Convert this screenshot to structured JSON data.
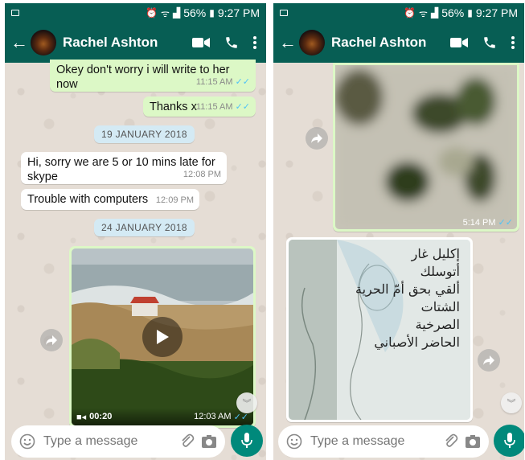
{
  "status_bar": {
    "battery": "56%",
    "time": "9:27 PM"
  },
  "contact": {
    "name": "Rachel Ashton"
  },
  "left_chat": {
    "messages": [
      {
        "text": "Okey don't worry i will write to her now",
        "time": "11:15 AM"
      },
      {
        "text": "Thanks x",
        "time": "11:15 AM"
      },
      {
        "text": "Hi, sorry we are 5 or 10 mins late for skype",
        "time": "12:08 PM"
      },
      {
        "text": "Trouble with computers",
        "time": "12:09 PM"
      }
    ],
    "date_chips": [
      "19 JANUARY 2018",
      "24 JANUARY 2018"
    ],
    "video": {
      "duration": "00:20",
      "time": "12:03 AM"
    }
  },
  "right_chat": {
    "image_time": "5:14 PM",
    "artwork_text": [
      "إكليل غار",
      "أتوسلك",
      "ألقي بحق أمّ الحرية",
      "الشتات",
      "الصرخية",
      "الحاضر الأصباني"
    ]
  },
  "composer": {
    "placeholder": "Type a message"
  },
  "colors": {
    "header": "#075e54",
    "outgoing": "#dcf8c6",
    "incoming": "#ffffff",
    "fab": "#00897b",
    "read_ticks": "#4fc3f7"
  }
}
